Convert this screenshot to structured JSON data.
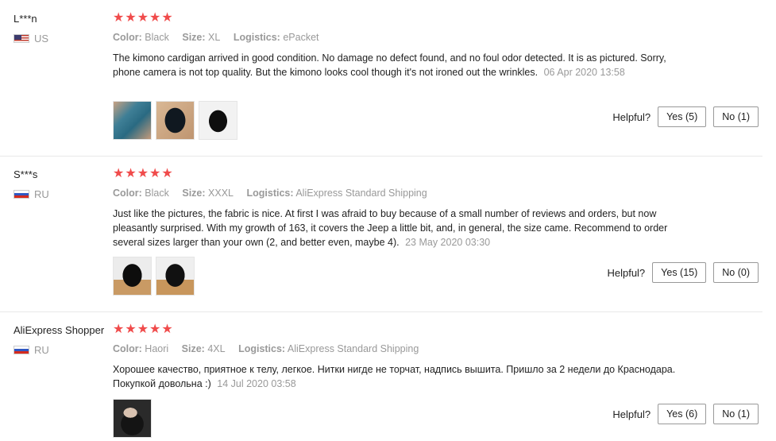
{
  "labels": {
    "color": "Color:",
    "size": "Size:",
    "logistics": "Logistics:",
    "helpful": "Helpful?"
  },
  "star_glyph": "★",
  "star_color": "#f04b4b",
  "reviews": [
    {
      "name": "L***n",
      "country": "US",
      "flag": "us-flag-icon",
      "rating": 5,
      "color": "Black",
      "size": "XL",
      "logistics": "ePacket",
      "text": "The kimono cardigan arrived in good condition. No damage no defect found, and no foul odor detected. It is as pictured. Sorry, phone camera is not top quality. But the kimono looks cool though it's not ironed out the wrinkles.",
      "date": "06 Apr 2020 13:58",
      "yes": "Yes (5)",
      "no": "No (1)"
    },
    {
      "name": "S***s",
      "country": "RU",
      "flag": "ru-flag-icon",
      "rating": 5,
      "color": "Black",
      "size": "XXXL",
      "logistics": "AliExpress Standard Shipping",
      "text": "Just like the pictures, the fabric is nice. At first I was afraid to buy because of a small number of reviews and orders, but now pleasantly surprised. With my growth of 163, it covers the Jeep a little bit, and, in general, the size came. Recommend to order several sizes larger than your own (2, and better even, maybe 4).",
      "date": "23 May 2020 03:30",
      "yes": "Yes (15)",
      "no": "No (0)"
    },
    {
      "name": "AliExpress Shopper",
      "country": "RU",
      "flag": "ru-flag-icon",
      "rating": 5,
      "color": "Haori",
      "size": "4XL",
      "logistics": "AliExpress Standard Shipping",
      "text": "Хорошее качество, приятное к телу, легкое. Нитки нигде не торчат, надпись вышита. Пришло за 2 недели до Краснодара. Покупкой довольна :)",
      "date": "14 Jul 2020 03:58",
      "yes": "Yes (6)",
      "no": "No (1)"
    }
  ]
}
